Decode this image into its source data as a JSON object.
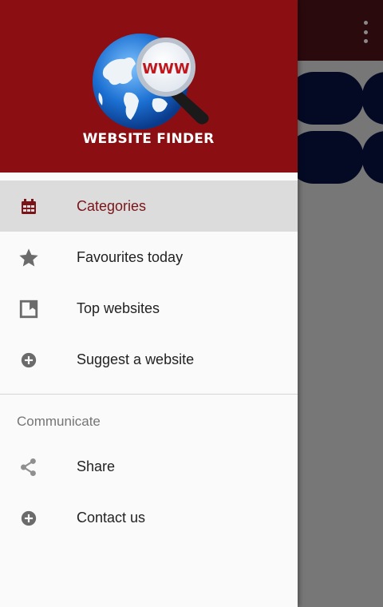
{
  "app": {
    "logo_text": "WEBSITE FINDER",
    "logo_globe_badge": "WWW",
    "brand_color": "#8b0e12"
  },
  "menu": {
    "primary": [
      {
        "label": "Categories",
        "icon": "calendar-icon",
        "active": true
      },
      {
        "label": "Favourites today",
        "icon": "star-icon",
        "active": false
      },
      {
        "label": "Top websites",
        "icon": "bookmark-page-icon",
        "active": false
      },
      {
        "label": "Suggest a website",
        "icon": "add-circle-icon",
        "active": false
      }
    ],
    "section_title": "Communicate",
    "secondary": [
      {
        "label": "Share",
        "icon": "share-icon"
      },
      {
        "label": "Contact us",
        "icon": "add-circle-icon"
      }
    ]
  },
  "background": {
    "overflow_icon": "more-vert-icon"
  }
}
